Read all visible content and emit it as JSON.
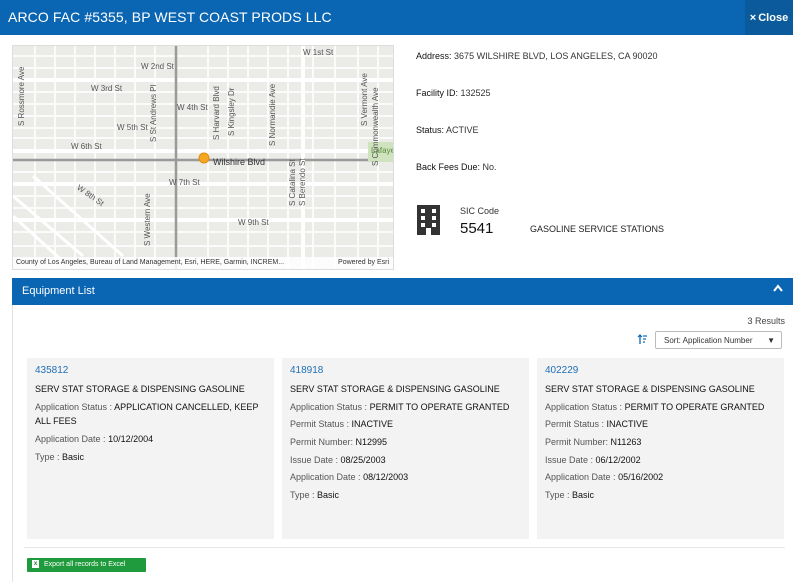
{
  "window": {
    "title": "ARCO FAC #5355, BP WEST COAST PRODS LLC",
    "close_label": "Close",
    "close_icon": "×"
  },
  "map": {
    "labels": [
      "W 1st St",
      "W 2nd St",
      "W 3rd St",
      "W 4th St",
      "W 5th St",
      "W 6th St",
      "Wilshire Blvd",
      "W 7th St",
      "W 8th St",
      "W 9th St",
      "S Western Ave",
      "S St Andrews Pl",
      "S Harvard Blvd",
      "S Kingsley Dr",
      "S Normandie Ave",
      "S Catalina St",
      "S Berendo St",
      "S Vermont Ave",
      "S Commonwealth Ave",
      "S Rossmore Ave",
      "Lafayette Park"
    ],
    "attribution": "County of Los Angeles, Bureau of Land Management, Esri, HERE, Garmin, INCREM...",
    "powered_by": "Powered by Esri",
    "marker_color": "#f5a623"
  },
  "facility": {
    "address_label": "Address:",
    "address_value": "3675 WILSHIRE BLVD, LOS ANGELES, CA 90020",
    "facility_id_label": "Facility ID:",
    "facility_id_value": "132525",
    "status_label": "Status:",
    "status_value": "ACTIVE",
    "back_fees_label": "Back Fees Due:",
    "back_fees_value": "No.",
    "sic_label": "SIC Code",
    "sic_code": "5541",
    "sic_description": "GASOLINE SERVICE STATIONS",
    "sic_icon": "building-icon"
  },
  "equipment": {
    "header": "Equipment List",
    "collapse_icon": "chevron-up-icon",
    "results": "3 Results",
    "sort_icon": "sort-icon",
    "sort_value": "Sort: Application Number",
    "cards": [
      {
        "id": "435812",
        "title": "SERV STAT STORAGE & DISPENSING GASOLINE",
        "app_status_label": "Application Status :",
        "app_status_value": "APPLICATION CANCELLED, KEEP ALL FEES",
        "app_date_label": "Application Date :",
        "app_date_value": "10/12/2004",
        "type_label": "Type :",
        "type_value": "Basic"
      },
      {
        "id": "418918",
        "title": "SERV STAT STORAGE & DISPENSING GASOLINE",
        "app_status_label": "Application Status :",
        "app_status_value": "PERMIT TO OPERATE GRANTED",
        "permit_status_label": "Permit Status :",
        "permit_status_value": "INACTIVE",
        "permit_number_label": "Permit Number:",
        "permit_number_value": "N12995",
        "issue_date_label": "Issue Date :",
        "issue_date_value": "08/25/2003",
        "app_date_label": "Application Date :",
        "app_date_value": "08/12/2003",
        "type_label": "Type :",
        "type_value": "Basic"
      },
      {
        "id": "402229",
        "title": "SERV STAT STORAGE & DISPENSING GASOLINE",
        "app_status_label": "Application Status :",
        "app_status_value": "PERMIT TO OPERATE GRANTED",
        "permit_status_label": "Permit Status :",
        "permit_status_value": "INACTIVE",
        "permit_number_label": "Permit Number:",
        "permit_number_value": "N11263",
        "issue_date_label": "Issue Date :",
        "issue_date_value": "06/12/2002",
        "app_date_label": "Application Date :",
        "app_date_value": "05/16/2002",
        "type_label": "Type :",
        "type_value": "Basic"
      }
    ],
    "export_label": "Export all records to Excel",
    "export_icon": "excel-icon"
  },
  "colors": {
    "header_blue": "#0a66b2",
    "link_blue": "#1f6fb5",
    "export_green": "#1f9a3c",
    "card_bg": "#f3f3f3"
  }
}
